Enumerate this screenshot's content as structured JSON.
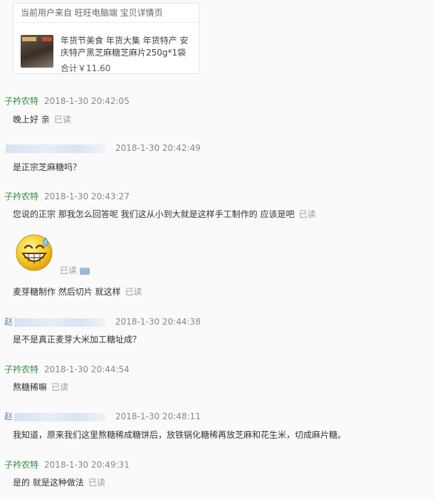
{
  "product_card": {
    "header": "当前用户来自 旺旺电脑端 宝贝详情页",
    "title": "年货节美食 年货大集 年货特产 安庆特产黑芝麻糖芝麻片250g*1袋",
    "total": "合计￥11.60"
  },
  "read_label": "已读",
  "messages": [
    {
      "sender": "子衿农特",
      "time": "2018-1-30 20:42:05",
      "text": "晚上好 亲",
      "read": "已读"
    },
    {
      "sender": "",
      "time": "2018-1-30 20:42:49",
      "text": "是正宗芝麻糖吗？"
    },
    {
      "sender": "子衿农特",
      "time": "2018-1-30 20:43:27",
      "text": "您说的正宗 那我怎么回答呢 我们这从小到大就是这样手工制作的 应该是吧",
      "read": "已读"
    },
    {
      "emoji": "sweat-smile-emoji",
      "read": "已读"
    },
    {
      "text": "麦芽糖制作 然后切片 就这样",
      "read": "已读"
    },
    {
      "sender": "赵",
      "time": "2018-1-30 20:44:38",
      "text": "是不是真正麦芽大米加工糖址成？"
    },
    {
      "sender": "子衿农特",
      "time": "2018-1-30 20:44:54",
      "text": "熬糖稀嘛",
      "read": "已读"
    },
    {
      "sender": "赵",
      "time": "2018-1-30 20:48:11",
      "text": "我知道，原来我们这里熬糖稀成糖饼后，放铁锅化糖稀再放芝麻和花生米，切成麻片糖。"
    },
    {
      "sender": "子衿农特",
      "time": "2018-1-30 20:49:31",
      "text": "是的 就是这种做法",
      "read": "已读"
    }
  ],
  "colors": {
    "seller_name": "#2e8b3c",
    "buyer_name": "#5a7fb8",
    "time": "#888888",
    "read": "#999999"
  }
}
